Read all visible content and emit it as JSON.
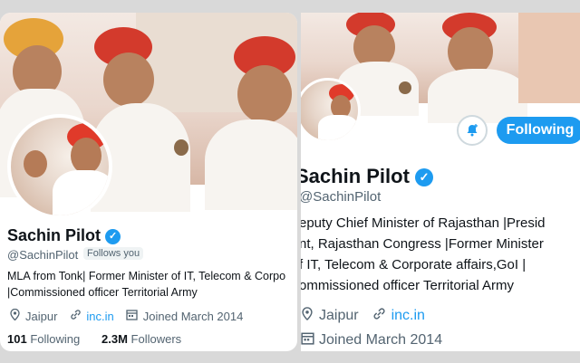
{
  "left": {
    "name": "Sachin Pilot",
    "handle": "@SachinPilot",
    "follows_badge": "Follows you",
    "bio_line1": "MLA from Tonk| Former Minister of IT, Telecom & Corpo",
    "bio_line2": "|Commissioned officer Territorial Army",
    "location": "Jaipur",
    "website": "inc.in",
    "joined": "Joined March 2014",
    "following_count": "101",
    "following_label": "Following",
    "followers_count": "2.3M",
    "followers_label": "Followers"
  },
  "right": {
    "name": "Sachin Pilot",
    "handle": "@SachinPilot",
    "bio_line1": "eputy Chief Minister of Rajasthan |Presid",
    "bio_line2": "nt, Rajasthan Congress |Former Minister",
    "bio_line3": "f IT, Telecom & Corporate affairs,GoI |",
    "bio_line4": "ommissioned officer Territorial Army",
    "location": "Jaipur",
    "website": "inc.in",
    "joined": "Joined March 2014",
    "follow_button": "Following"
  },
  "icons": {
    "verified": "✓",
    "location": "location-pin-icon",
    "link": "link-icon",
    "calendar": "calendar-icon",
    "bell": "bell-add-icon"
  },
  "colors": {
    "accent": "#1d9bf0",
    "text": "#0f1419",
    "muted": "#536471"
  }
}
